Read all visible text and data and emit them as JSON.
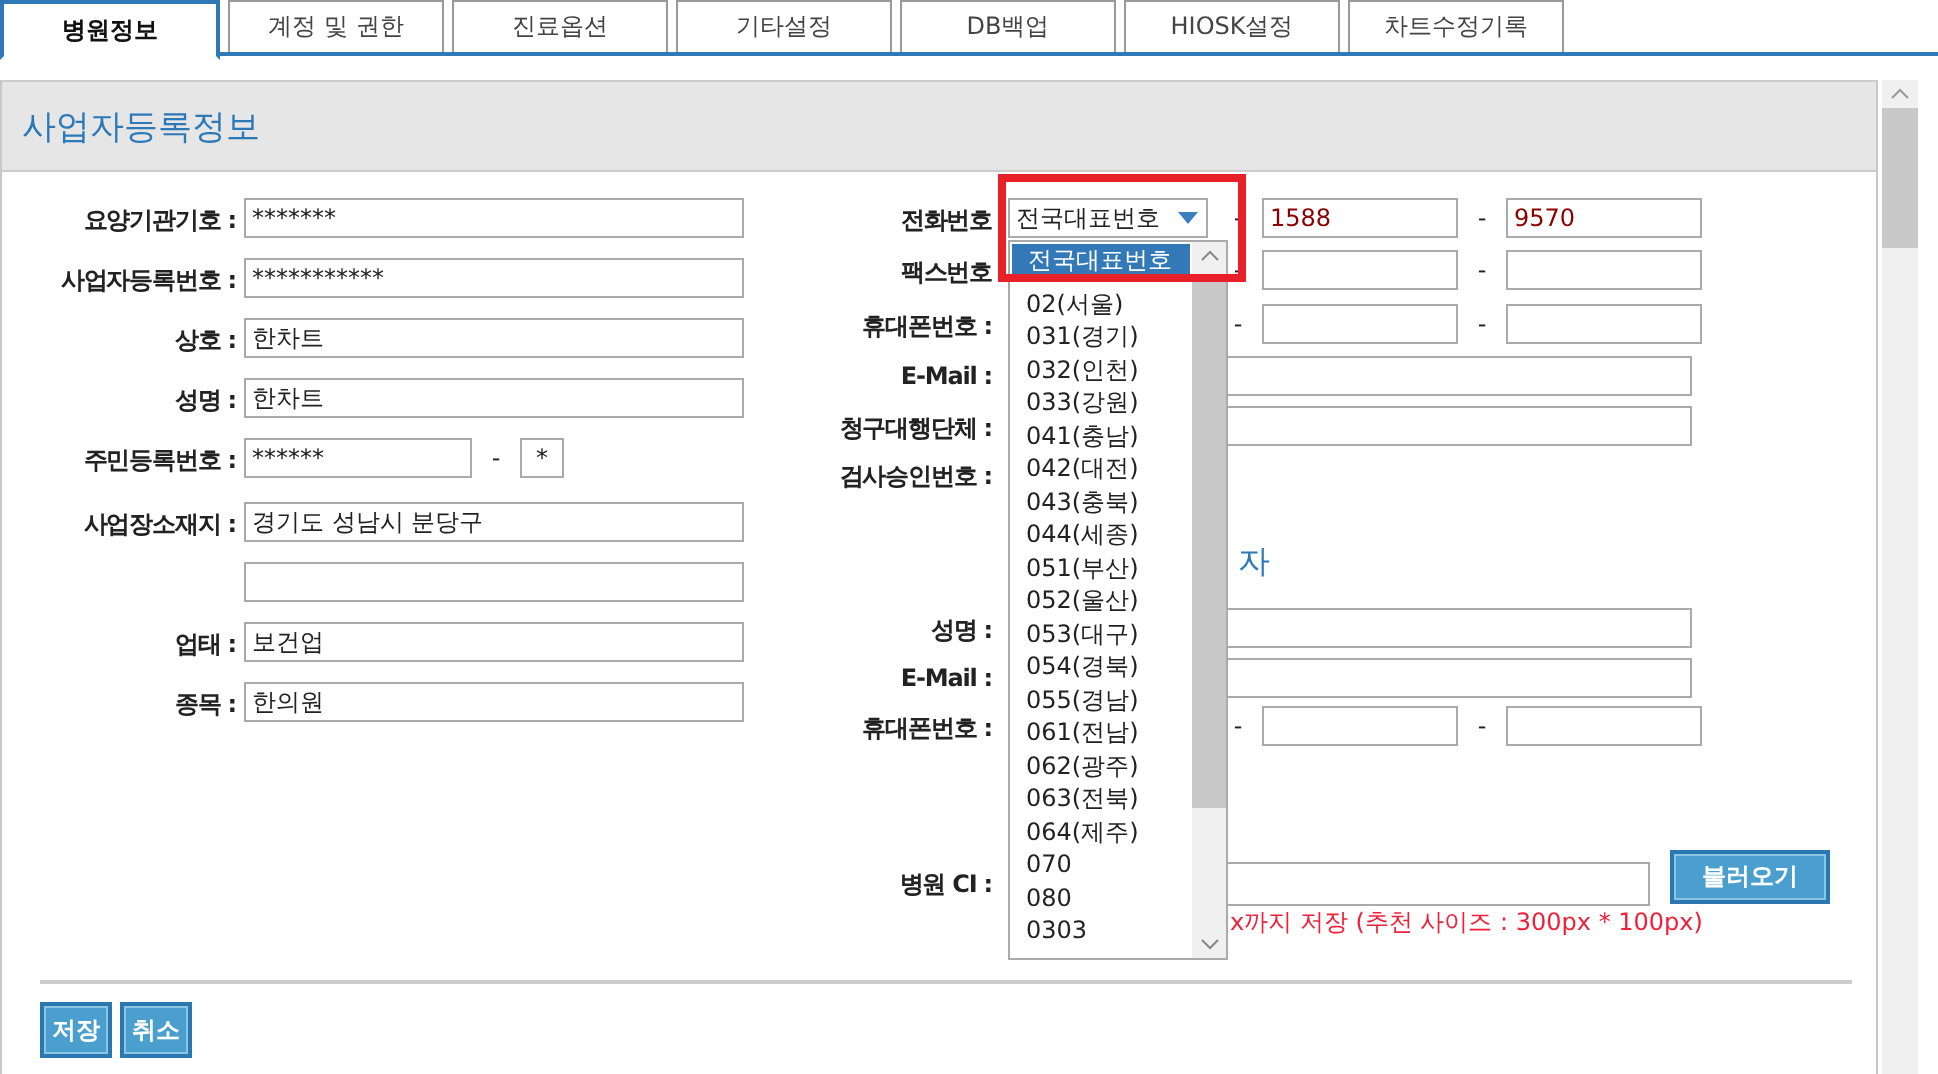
{
  "tabs": [
    {
      "label": "병원정보",
      "selected": true
    },
    {
      "label": "계정 및 권한",
      "selected": false
    },
    {
      "label": "진료옵션",
      "selected": false
    },
    {
      "label": "기타설정",
      "selected": false
    },
    {
      "label": "DB백업",
      "selected": false
    },
    {
      "label": "HIOSK설정",
      "selected": false
    },
    {
      "label": "차트수정기록",
      "selected": false
    }
  ],
  "section_title": "사업자등록정보",
  "left_fields": [
    {
      "label": "요양기관기호 :",
      "kind": "text",
      "value": "*******"
    },
    {
      "label": "사업자등록번호 :",
      "kind": "text",
      "value": "***********"
    },
    {
      "label": "상호 :",
      "kind": "text",
      "value": "한차트"
    },
    {
      "label": "성명 :",
      "kind": "text",
      "value": "한차트"
    },
    {
      "label": "주민등록번호 :",
      "kind": "split",
      "value": "******",
      "separator": "-",
      "value_2": "*"
    },
    {
      "label": "사업장소재지 :",
      "kind": "text",
      "value": "경기도 성남시 분당구"
    },
    {
      "kind": "text"
    },
    {
      "label": "업태 :",
      "kind": "text",
      "value": "보건업"
    },
    {
      "label": "종목 :",
      "kind": "text",
      "value": "한의원"
    }
  ],
  "right_fields": [
    {
      "label": "전화번호",
      "kind": "phone",
      "select": "전국대표번호",
      "separator": "-",
      "value_2": "1588",
      "value_3": "9570"
    },
    {
      "label": "팩스번호",
      "kind": "phone",
      "separator": "-"
    },
    {
      "label": "휴대폰번호 :",
      "kind": "phone",
      "separator": "-"
    },
    {
      "label": "E-Mail :",
      "kind": "text"
    },
    {
      "label": "청구대행단체 :",
      "kind": "text"
    },
    {
      "label": "검사승인번호 :",
      "kind": "blank"
    }
  ],
  "subsection_title": "자",
  "right_fields_2": [
    {
      "label": "성명 :",
      "kind": "text"
    },
    {
      "label": "E-Mail :",
      "kind": "text"
    },
    {
      "label": "휴대폰번호 :",
      "kind": "phone",
      "separator": "-"
    }
  ],
  "ci": {
    "label": "병원 CI :",
    "button": "불러오기",
    "note": "x까지 저장 (추천 사이즈 : 300px * 100px)"
  },
  "dropdown": {
    "highlighted": true,
    "options": [
      {
        "label": "전국대표번호",
        "selected": true
      },
      {
        "label": "02(서울)",
        "selected": false
      },
      {
        "label": "031(경기)",
        "selected": false
      },
      {
        "label": "032(인천)",
        "selected": false
      },
      {
        "label": "033(강원)",
        "selected": false
      },
      {
        "label": "041(충남)",
        "selected": false
      },
      {
        "label": "042(대전)",
        "selected": false
      },
      {
        "label": "043(충북)",
        "selected": false
      },
      {
        "label": "044(세종)",
        "selected": false
      },
      {
        "label": "051(부산)",
        "selected": false
      },
      {
        "label": "052(울산)",
        "selected": false
      },
      {
        "label": "053(대구)",
        "selected": false
      },
      {
        "label": "054(경북)",
        "selected": false
      },
      {
        "label": "055(경남)",
        "selected": false
      },
      {
        "label": "061(전남)",
        "selected": false
      },
      {
        "label": "062(광주)",
        "selected": false
      },
      {
        "label": "063(전북)",
        "selected": false
      },
      {
        "label": "064(제주)",
        "selected": false
      },
      {
        "label": "070",
        "selected": false
      },
      {
        "label": "080",
        "selected": false
      },
      {
        "label": "0303",
        "selected": false
      }
    ]
  },
  "buttons": [
    "저장",
    "취소"
  ]
}
